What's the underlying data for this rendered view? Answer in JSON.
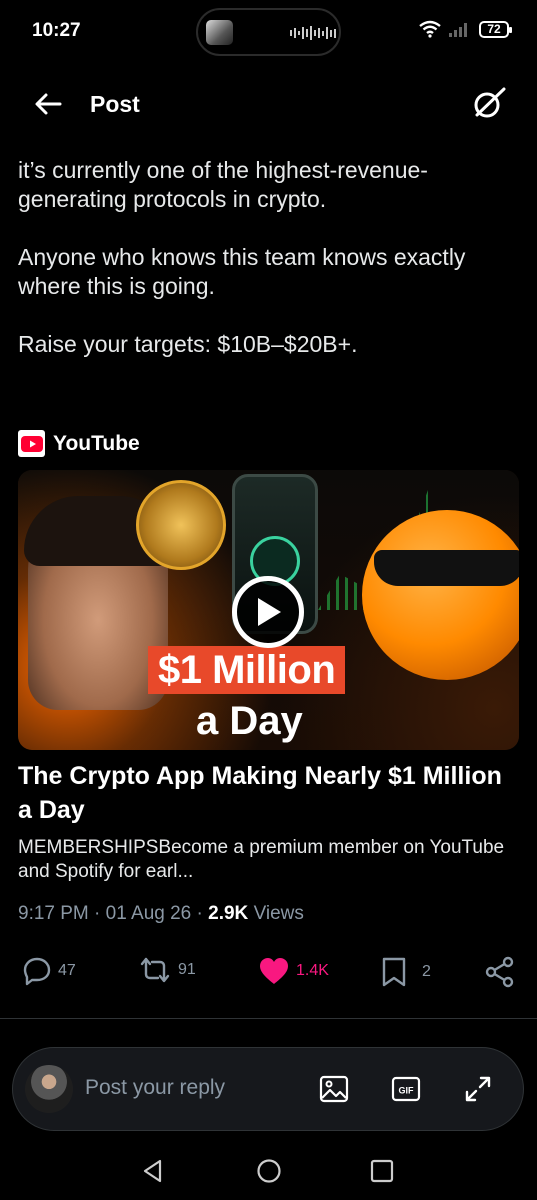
{
  "status_bar": {
    "time": "10:27",
    "battery": "72"
  },
  "header": {
    "title": "Post"
  },
  "post": {
    "paragraphs": [
      "it’s currently one of the highest-revenue-generating protocols in crypto.",
      "Anyone who knows this team knows exactly where this is going.",
      "Raise your targets: $10B–$20B+."
    ]
  },
  "card": {
    "source": "YouTube",
    "thumbnail_banner": "$1 Million",
    "thumbnail_sub": "a Day",
    "title": "The Crypto App Making Nearly $1 Million a Day",
    "description": "MEMBERSHIPSBecome a premium member on YouTube and Spotify for earl..."
  },
  "meta": {
    "time": "9:17 PM",
    "date": "01 Aug 26",
    "views_count": "2.9K",
    "views_label": "Views"
  },
  "actions": {
    "replies": "47",
    "reposts": "91",
    "likes": "1.4K",
    "bookmarks": "2"
  },
  "colors": {
    "like": "#f91880",
    "muted": "#8b98a5",
    "youtube_red": "#ff0033"
  },
  "reply_bar": {
    "placeholder": "Post your reply"
  },
  "icons": [
    "back-arrow-icon",
    "grok-icon",
    "youtube-icon",
    "play-icon",
    "reply-icon",
    "repost-icon",
    "heart-icon",
    "bookmark-icon",
    "share-icon",
    "image-icon",
    "gif-icon",
    "expand-icon",
    "nav-back-icon",
    "nav-home-icon",
    "nav-recents-icon"
  ]
}
